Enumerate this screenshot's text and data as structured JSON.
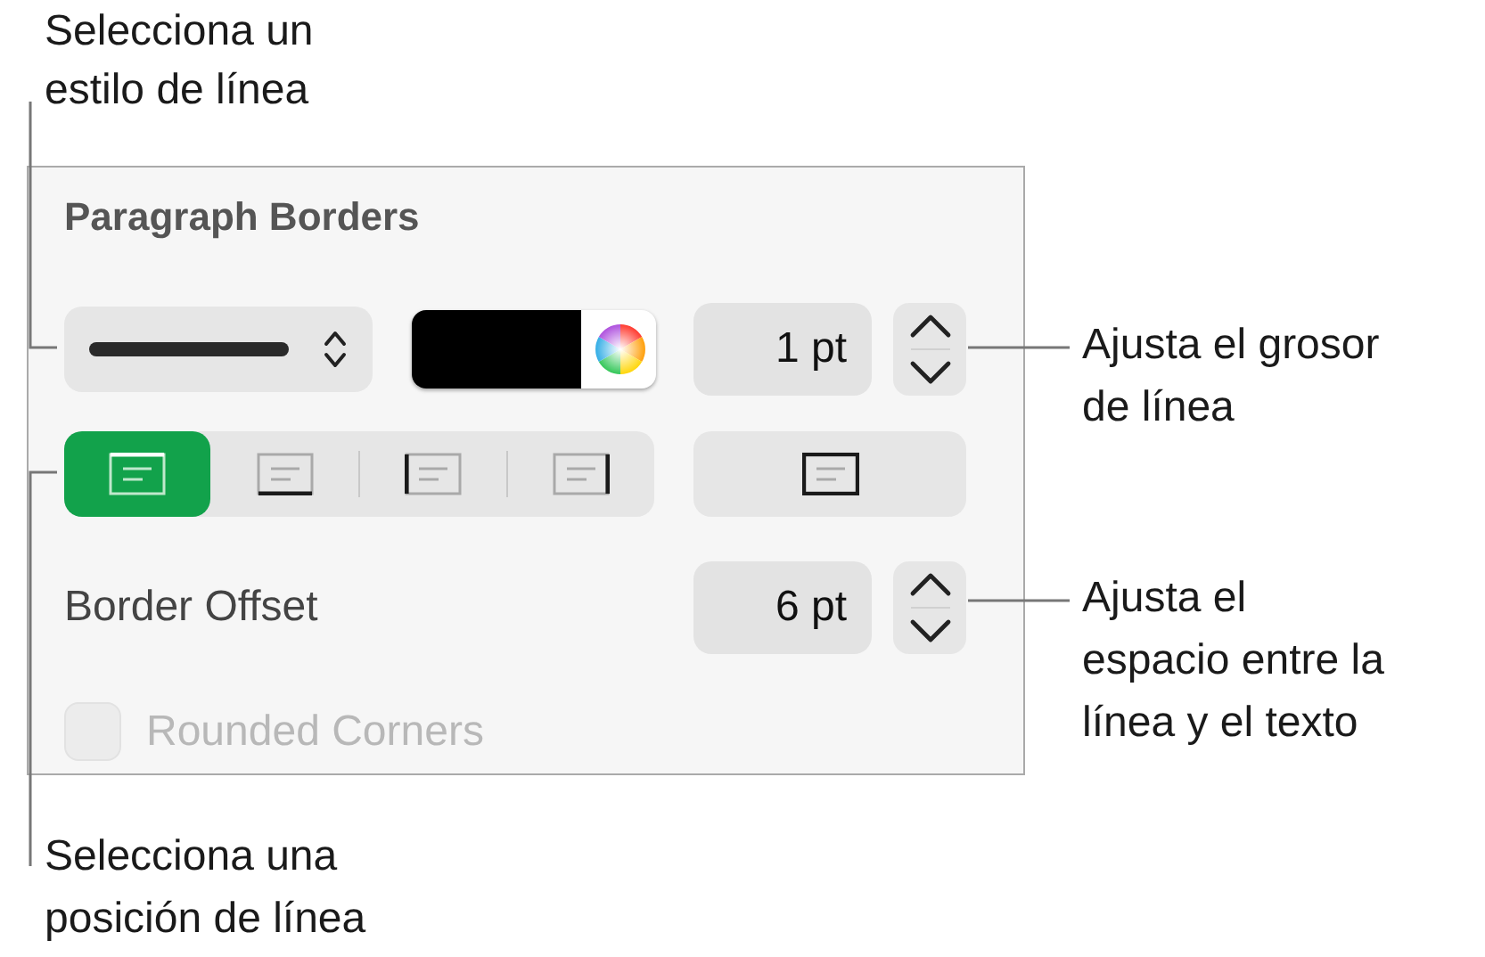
{
  "callouts": [
    {
      "text": "Selecciona un\nestilo de línea"
    },
    {
      "text": "Ajusta el grosor\nde línea"
    },
    {
      "text": "Ajusta el\nespacio entre la\nlínea y el texto"
    },
    {
      "text": "Selecciona una\nposición de línea"
    }
  ],
  "panel": {
    "title": "Paragraph Borders",
    "width_field": {
      "value": "1 pt"
    },
    "positions": [
      {
        "kind": "top",
        "selected": true
      },
      {
        "kind": "bottom",
        "selected": false
      },
      {
        "kind": "left",
        "selected": false
      },
      {
        "kind": "right",
        "selected": false
      }
    ],
    "outline": {
      "selected": false
    },
    "offset": {
      "label": "Border Offset",
      "value": "6 pt"
    },
    "rounded_corners": {
      "label": "Rounded Corners",
      "checked": false,
      "disabled": true
    }
  }
}
